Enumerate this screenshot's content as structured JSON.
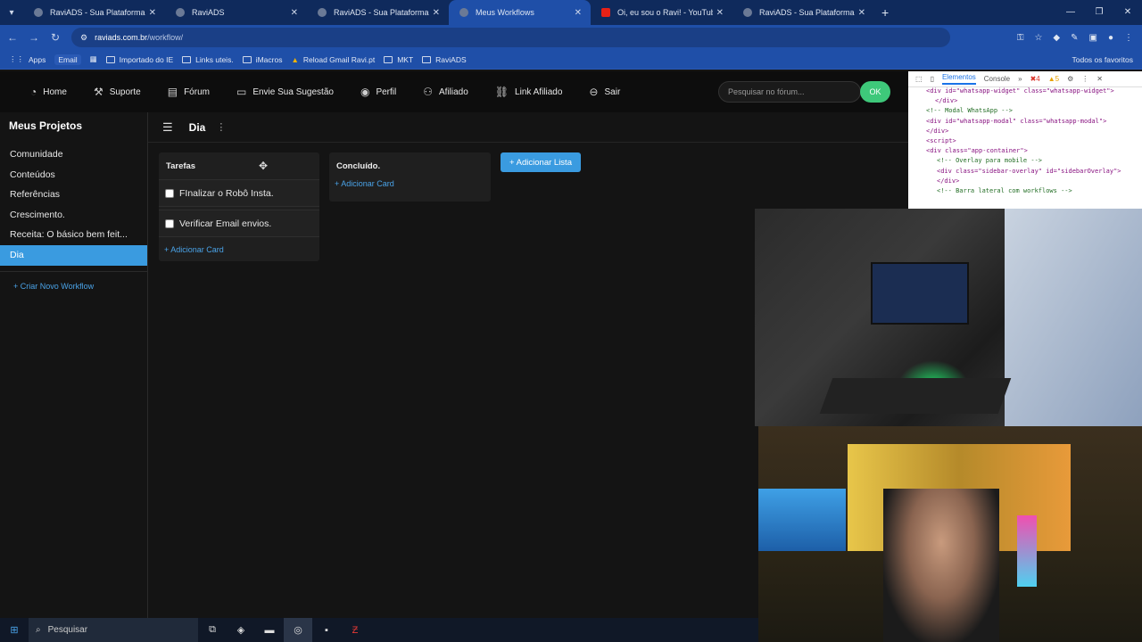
{
  "browser": {
    "tabs": [
      {
        "title": "RaviADS - Sua Plataforma Comp",
        "close": "✕"
      },
      {
        "title": "RaviADS",
        "close": "✕"
      },
      {
        "title": "RaviADS - Sua Plataforma Comp",
        "close": "✕"
      },
      {
        "title": "Meus Workflows",
        "close": "✕"
      },
      {
        "title": "Oi, eu sou o Ravi! - YouTube",
        "close": "✕"
      },
      {
        "title": "RaviADS - Sua Plataforma Comp",
        "close": "✕"
      }
    ],
    "new_tab": "+",
    "url_domain": "raviads.com.br",
    "url_path": "/workflow/",
    "bookmarks": [
      "Apps",
      "Email",
      "Importado do IE",
      "Links uteis.",
      "iMacros",
      "Reload Gmail Ravi.pt",
      "MKT",
      "RaviADS"
    ],
    "bookmarks_right": "Todos os favoritos"
  },
  "site_nav": {
    "items": [
      {
        "label": "Home",
        "icon": "dashboard-icon"
      },
      {
        "label": "Suporte",
        "icon": "support-icon"
      },
      {
        "label": "Fórum",
        "icon": "forum-icon"
      },
      {
        "label": "Envie Sua Sugestão",
        "icon": "comment-icon"
      },
      {
        "label": "Perfil",
        "icon": "user-icon"
      },
      {
        "label": "Afiliado",
        "icon": "affiliate-icon"
      },
      {
        "label": "Link Afiliado",
        "icon": "link-icon"
      },
      {
        "label": "Sair",
        "icon": "logout-icon"
      }
    ],
    "search_placeholder": "Pesquisar no fórum...",
    "search_button": "OK"
  },
  "devtools": {
    "tabs": [
      "Elementos",
      "Console"
    ],
    "errors": "4",
    "warnings": "5",
    "lines": [
      "<div id=\"whatsapp-widget\" class=\"whatsapp-widget\">",
      "</div>",
      "<!-- Modal WhatsApp -->",
      "<div id=\"whatsapp-modal\" class=\"whatsapp-modal\">",
      "</div>",
      "<script>",
      "<div class=\"app-container\">",
      "<!-- Overlay para mobile -->",
      "<div class=\"sidebar-overlay\" id=\"sidebarOverlay\">",
      "</div>",
      "<!-- Barra lateral com workflows -->"
    ]
  },
  "sidebar": {
    "title": "Meus Projetos",
    "items": [
      "Comunidade",
      "Conteúdos",
      "Referências",
      "Crescimento.",
      "Receita: O básico bem feit...",
      "Dia"
    ],
    "active_index": 5,
    "new_workflow": "+ Criar Novo Workflow"
  },
  "board": {
    "title": "Dia",
    "lists": [
      {
        "title": "Tarefas",
        "cards": [
          "FInalizar o Robô Insta.",
          "Verificar Email envios."
        ],
        "add_card": "+ Adicionar Card"
      },
      {
        "title": "Concluído.",
        "cards": [],
        "add_card": "+ Adicionar Card"
      }
    ],
    "add_list": "+ Adicionar Lista"
  },
  "taskbar": {
    "search_label": "Pesquisar"
  },
  "colors": {
    "accent": "#3a9be0",
    "ok_button": "#3ec87a",
    "browser_chrome": "#1f4fa8"
  }
}
